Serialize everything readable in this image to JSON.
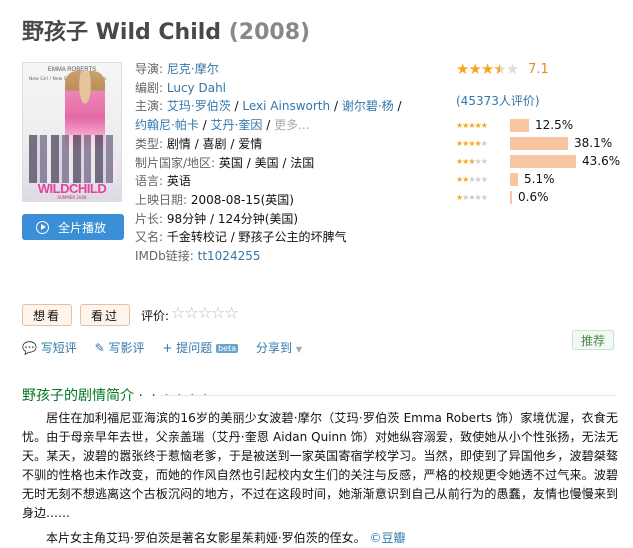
{
  "header": {
    "title": "野孩子 Wild Child",
    "year": "(2008)"
  },
  "poster": {
    "top_text": "EMMA ROBERTS",
    "tagline": "New Girl / New School / New Rules",
    "title_text": "WILDCHILD",
    "date_text": "SUMMER 2008"
  },
  "play_button": {
    "label": "全片播放"
  },
  "info": {
    "director_label": "导演:",
    "director": "尼克·摩尔",
    "writer_label": "编剧:",
    "writer": "Lucy Dahl",
    "cast_label": "主演:",
    "cast": [
      "艾玛·罗伯茨",
      "Lexi Ainsworth",
      "谢尔碧·杨",
      "约翰尼·帕卡",
      "艾丹·奎因"
    ],
    "cast_more": "更多...",
    "genre_label": "类型:",
    "genre": "剧情 / 喜剧 / 爱情",
    "country_label": "制片国家/地区:",
    "country": "英国 / 美国 / 法国",
    "language_label": "语言:",
    "language": "英语",
    "release_label": "上映日期:",
    "release": "2008-08-15(英国)",
    "runtime_label": "片长:",
    "runtime": "98分钟 / 124分钟(美国)",
    "aka_label": "又名:",
    "aka": "千金转校记 / 野孩子公主的坏脾气",
    "imdb_label": "IMDb链接:",
    "imdb": "tt1024255"
  },
  "rating": {
    "score": "7.1",
    "stars_filled": 3.5,
    "count_text": "(45373人评价)",
    "distribution": [
      {
        "stars": 5,
        "percent": 12.5,
        "label": "12.5%"
      },
      {
        "stars": 4,
        "percent": 38.1,
        "label": "38.1%"
      },
      {
        "stars": 3,
        "percent": 43.6,
        "label": "43.6%"
      },
      {
        "stars": 2,
        "percent": 5.1,
        "label": "5.1%"
      },
      {
        "stars": 1,
        "percent": 0.6,
        "label": "0.6%"
      }
    ]
  },
  "user_actions": {
    "want_label": "想看",
    "seen_label": "看过",
    "rate_label": "评价:"
  },
  "links": {
    "short_review": "写短评",
    "review": "写影评",
    "ask": "提问题",
    "beta": "beta",
    "share": "分享到"
  },
  "recommend_label": "推荐",
  "summary": {
    "title": "野孩子的剧情简介",
    "dots": "· · · · · ·",
    "paragraph": "居住在加利福尼亚海滨的16岁的美丽少女波碧·摩尔（艾玛·罗伯茨 Emma Roberts 饰）家境优渥，衣食无忧。由于母亲早年去世，父亲盖瑞（艾丹·奎恩 Aidan Quinn 饰）对她纵容溺爱，致使她从小个性张扬，无法无天。某天，波碧的嚣张终于惹恼老爹，于是被送到一家英国寄宿学校学习。当然，即使到了异国他乡，波碧桀骜不驯的性格也未作改变，而她的作风自然也引起校内女生们的关注与反感，严格的校规更令她透不过气来。波碧无时无刻不想逃离这个古板沉闷的地方，不过在这段时间，她渐渐意识到自己从前行为的愚蠢，友情也慢慢来到身边……",
    "note": "本片女主角艾玛·罗伯茨是著名女影星茱莉娅·罗伯茨的侄女。",
    "credit": "©豆瓣"
  }
}
